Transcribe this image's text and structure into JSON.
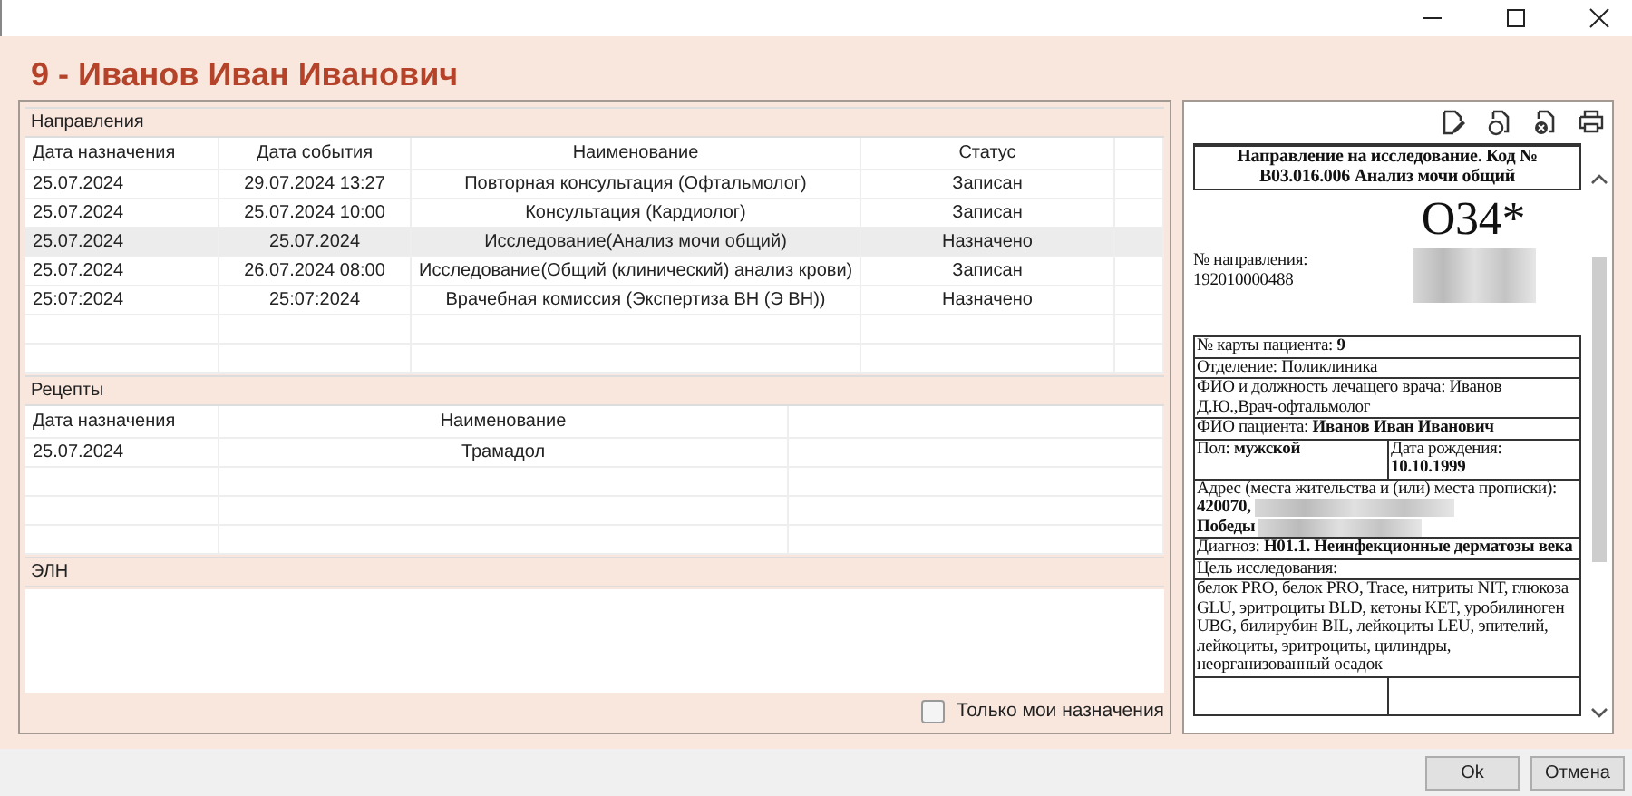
{
  "header": {
    "title": "9 - Иванов Иван Иванович"
  },
  "directions": {
    "title": "Направления",
    "columns": [
      "Дата назначения",
      "Дата события",
      "Наименование",
      "Статус"
    ],
    "rows": [
      {
        "cells": [
          "25.07.2024",
          "29.07.2024 13:27",
          "Повторная консультация (Офтальмолог)",
          "Записан"
        ],
        "selected": false
      },
      {
        "cells": [
          "25.07.2024",
          "25.07.2024 10:00",
          "Консультация (Кардиолог)",
          "Записан"
        ],
        "selected": false
      },
      {
        "cells": [
          "25.07.2024",
          "25.07.2024",
          "Исследование(Анализ мочи общий)",
          "Назначено"
        ],
        "selected": true
      },
      {
        "cells": [
          "25.07.2024",
          "26.07.2024 08:00",
          "Исследование(Общий (клинический) анализ крови)",
          "Записан"
        ],
        "selected": false
      },
      {
        "cells": [
          "25:07:2024",
          "25:07:2024",
          "Врачебная комиссия (Экспертиза ВН (Э ВН))",
          "Назначено"
        ],
        "selected": false
      }
    ]
  },
  "recipes": {
    "title": "Рецепты",
    "columns": [
      "Дата назначения",
      "Наименование"
    ],
    "rows": [
      {
        "cells": [
          "25.07.2024",
          "Трамадол"
        ]
      }
    ]
  },
  "eln": {
    "title": "ЭЛН"
  },
  "only_mine": {
    "label": "Только мои назначения",
    "checked": false
  },
  "document": {
    "title": "Направление на исследование. Код № В03.016.006 Анализ мочи общий",
    "code": "О34*",
    "referral_label": "№ направления:",
    "referral_number": "192010000488",
    "rows": [
      {
        "kind": "text",
        "cells": [
          "№ карты пациента: **9**"
        ]
      },
      {
        "kind": "text",
        "cells": [
          "Отделение: Поликлиника"
        ]
      },
      {
        "kind": "text",
        "cells": [
          "ФИО и должность лечащего врача: Иванов Д.Ю.,Врач-офтальмолог"
        ]
      },
      {
        "kind": "text",
        "cells": [
          "ФИО пациента: **Иванов Иван Иванович**"
        ]
      },
      {
        "kind": "text",
        "cells": [
          "Пол: **мужской**",
          "Дата рождения: **10.10.1999**"
        ]
      },
      {
        "kind": "address",
        "label": "Адрес (места жительства и (или) места прописки):",
        "lines": [
          "420070,",
          "Победы"
        ]
      },
      {
        "kind": "text",
        "cells": [
          "Диагноз: **Н01.1. Неинфекционные дерматозы века**"
        ]
      },
      {
        "kind": "text",
        "cells": [
          "Цель исследования:"
        ]
      },
      {
        "kind": "text",
        "cells": [
          "белок PRO, белок PRO, Trace, нитриты NIT, глюкоза GLU, эритроциты BLD, кетоны KET, уробилиноген UBG, билирубин BIL, лейкоциты LEU, эпителий, лейкоциты, эритроциты, цилиндры, неорганизованный осадок"
        ]
      }
    ]
  },
  "buttons": [
    "Ok",
    "Отмена"
  ]
}
